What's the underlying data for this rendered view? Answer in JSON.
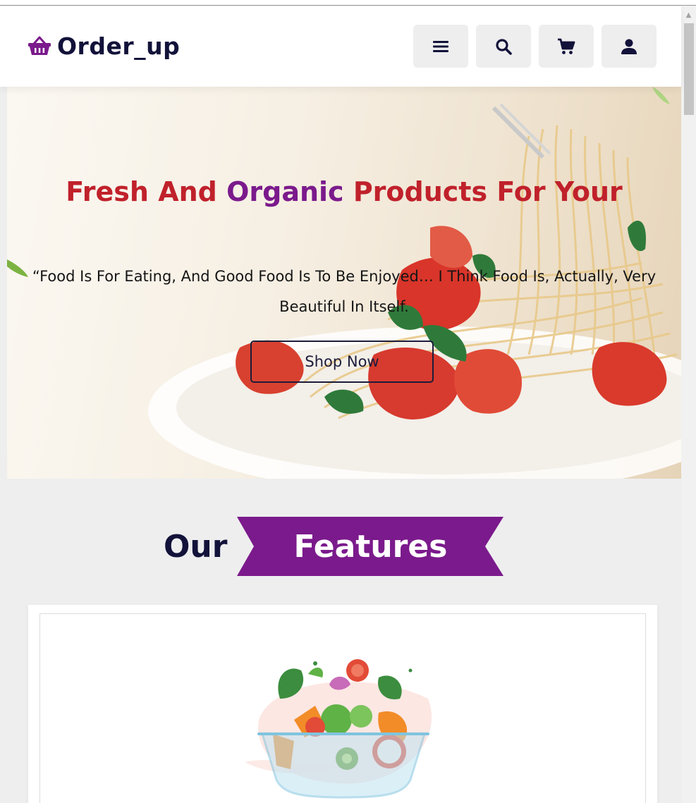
{
  "header": {
    "brand": "Order_up",
    "logo_icon": "basket-icon",
    "buttons": [
      {
        "name": "menu-button",
        "icon": "bars-icon"
      },
      {
        "name": "search-button",
        "icon": "search-icon"
      },
      {
        "name": "cart-button",
        "icon": "cart-icon"
      },
      {
        "name": "user-button",
        "icon": "user-icon"
      }
    ]
  },
  "hero": {
    "title_part1": "Fresh And ",
    "title_part2": "Organic",
    "title_part3": " Products For Your",
    "quote": "“Food Is For Eating, And Good Food Is To Be Enjoyed… I Think Food Is, Actually, Very Beautiful In Itself.",
    "cta": "Shop Now"
  },
  "features": {
    "heading_plain": "Our",
    "heading_highlight": "Features"
  },
  "colors": {
    "brand_dark": "#12123a",
    "accent_purple": "#7b1a8c",
    "hero_red": "#c0212b",
    "page_bg": "#eeeeef"
  }
}
